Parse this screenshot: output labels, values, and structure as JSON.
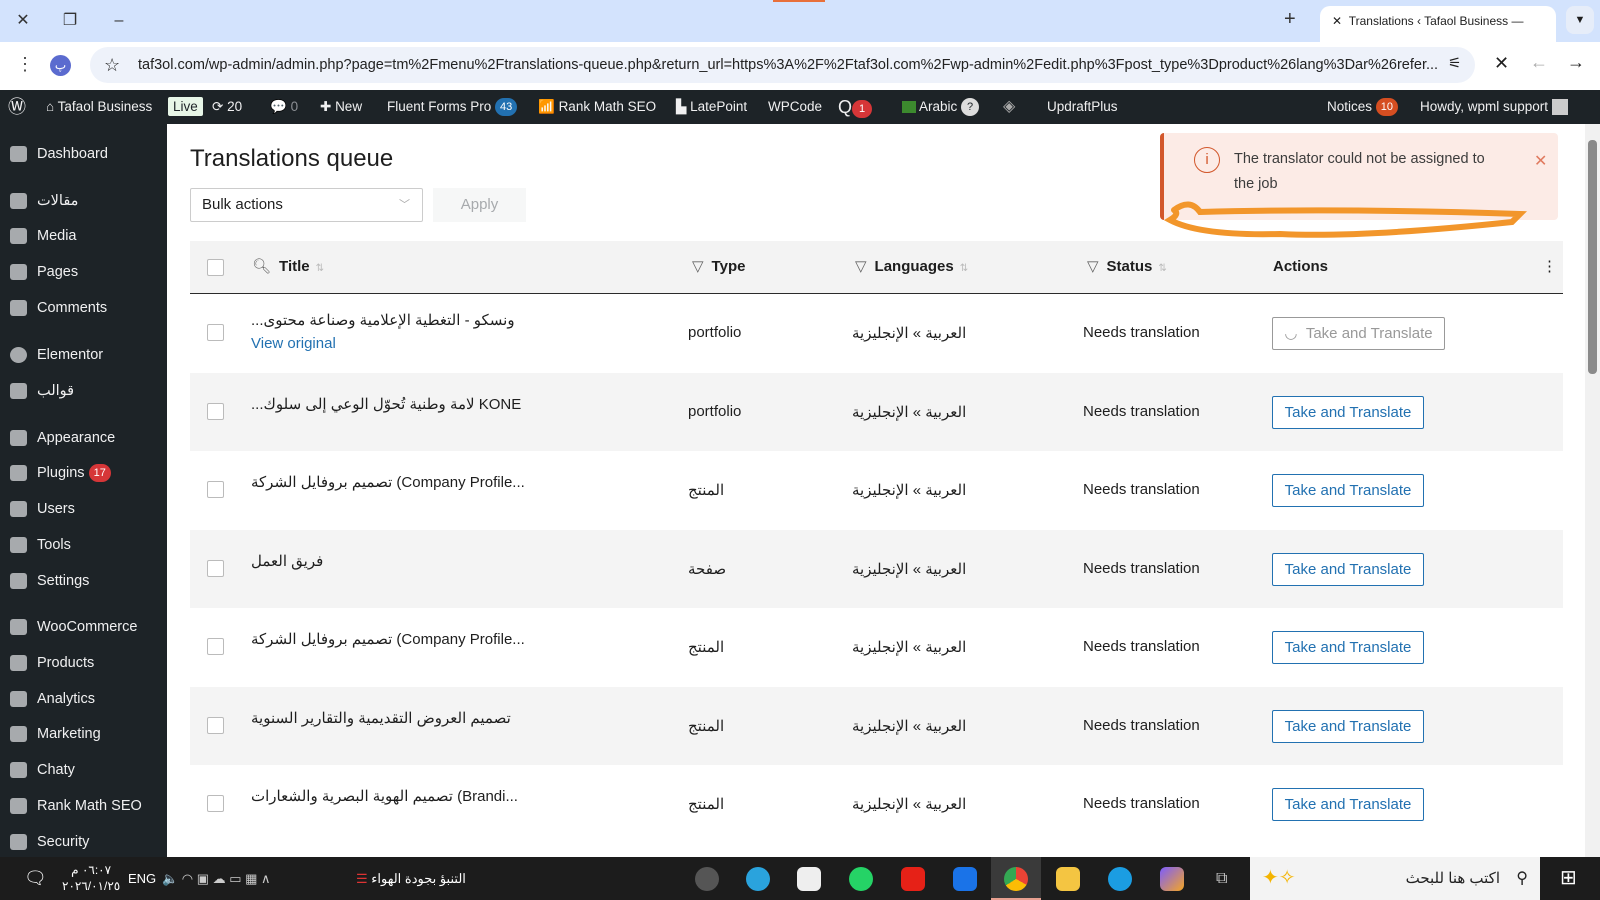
{
  "browser": {
    "tab_title": "Translations ‹ Tafaol Business —",
    "url": "taf3ol.com/wp-admin/admin.php?page=tm%2Fmenu%2Ftranslations-queue.php&return_url=https%3A%2F%2Ftaf3ol.com%2Fwp-admin%2Fedit.php%3Fpost_type%3Dproduct%26lang%3Dar%26refer...",
    "profile_initial": "پ"
  },
  "adminbar": {
    "site": "Tafaol Business",
    "live": "Live",
    "updates": "20",
    "comments": "0",
    "new": "New",
    "fluent": "Fluent Forms Pro",
    "fluent_count": "43",
    "rankmath": "Rank Math SEO",
    "latepoint": "LatePoint",
    "wpcode": "WPCode",
    "q_count": "1",
    "lang": "Arabic",
    "help": "?",
    "updraft": "UpdraftPlus",
    "notices": "Notices",
    "notices_count": "10",
    "howdy": "Howdy, wpml support"
  },
  "sidebar": {
    "items": [
      {
        "label": "Dashboard"
      },
      {
        "label": "مقالات"
      },
      {
        "label": "Media"
      },
      {
        "label": "Pages"
      },
      {
        "label": "Comments"
      },
      {
        "label": "Elementor"
      },
      {
        "label": "قوالب"
      },
      {
        "label": "Appearance"
      },
      {
        "label": "Plugins",
        "badge": "17"
      },
      {
        "label": "Users"
      },
      {
        "label": "Tools"
      },
      {
        "label": "Settings"
      },
      {
        "label": "WooCommerce"
      },
      {
        "label": "Products"
      },
      {
        "label": "Analytics"
      },
      {
        "label": "Marketing"
      },
      {
        "label": "Chaty"
      },
      {
        "label": "Rank Math SEO"
      },
      {
        "label": "Security"
      }
    ]
  },
  "page": {
    "title": "Translations queue",
    "bulk": "Bulk actions",
    "apply": "Apply"
  },
  "notice": {
    "message": "The translator could not be assigned to the job",
    "color": "#d2572b"
  },
  "table": {
    "headers": {
      "title": "Title",
      "type": "Type",
      "languages": "Languages",
      "status": "Status",
      "actions": "Actions"
    },
    "view_original": "View original",
    "rows": [
      {
        "title": "...ونسكو - التغطية الإعلامية وصناعة محتوى",
        "type": "portfolio",
        "lang": "العربية » الإنجليزية",
        "status": "Needs translation",
        "action": "Take and Translate"
      },
      {
        "title": "...لامة وطنية تُحوّل الوعي إلى سلوك KONE",
        "type": "portfolio",
        "lang": "العربية » الإنجليزية",
        "status": "Needs translation",
        "action": "Take and Translate"
      },
      {
        "title": "تصميم بروفايل الشركة (Company Profile...",
        "type": "المنتج",
        "lang": "العربية » الإنجليزية",
        "status": "Needs translation",
        "action": "Take and Translate"
      },
      {
        "title": "فريق العمل",
        "type": "صفحة",
        "lang": "العربية » الإنجليزية",
        "status": "Needs translation",
        "action": "Take and Translate"
      },
      {
        "title": "تصميم بروفايل الشركة (Company Profile...",
        "type": "المنتج",
        "lang": "العربية » الإنجليزية",
        "status": "Needs translation",
        "action": "Take and Translate"
      },
      {
        "title": "تصميم العروض التقديمية والتقارير السنوية",
        "type": "المنتج",
        "lang": "العربية » الإنجليزية",
        "status": "Needs translation",
        "action": "Take and Translate"
      },
      {
        "title": "تصميم الهوية البصرية والشعارات (Brandi...",
        "type": "المنتج",
        "lang": "العربية » الإنجليزية",
        "status": "Needs translation",
        "action": "Take and Translate"
      }
    ]
  },
  "taskbar": {
    "time": "٠٦:٠٧ م",
    "date": "٢٠٢٦/٠١/٢٥",
    "lang": "ENG",
    "weather": "التنبؤ بجودة الهواء",
    "search": "اكتب هنا للبحث"
  }
}
